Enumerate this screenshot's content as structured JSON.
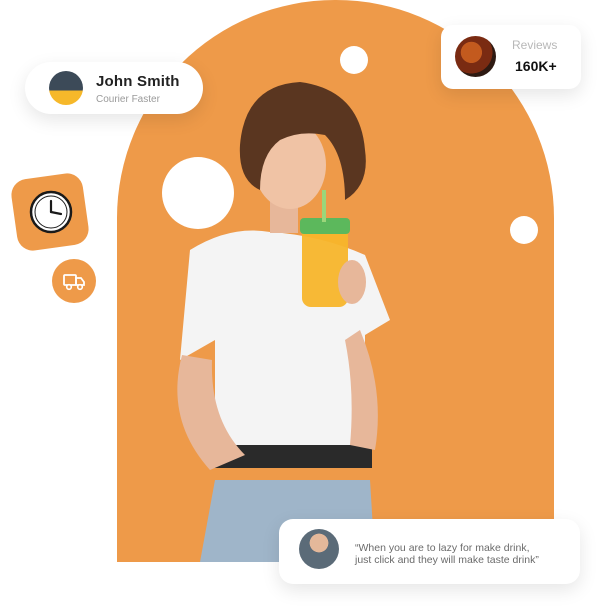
{
  "user_card": {
    "name": "John Smith",
    "role": "Courier Faster"
  },
  "reviews_card": {
    "label": "Reviews",
    "value": "160K+"
  },
  "testimonial": {
    "line1": "“When you are to lazy for make drink,",
    "line2": "just click and they will make taste drink”"
  },
  "colors": {
    "accent": "#EE9A49",
    "card": "#ffffff"
  },
  "icons": [
    "clock-icon",
    "truck-icon"
  ]
}
